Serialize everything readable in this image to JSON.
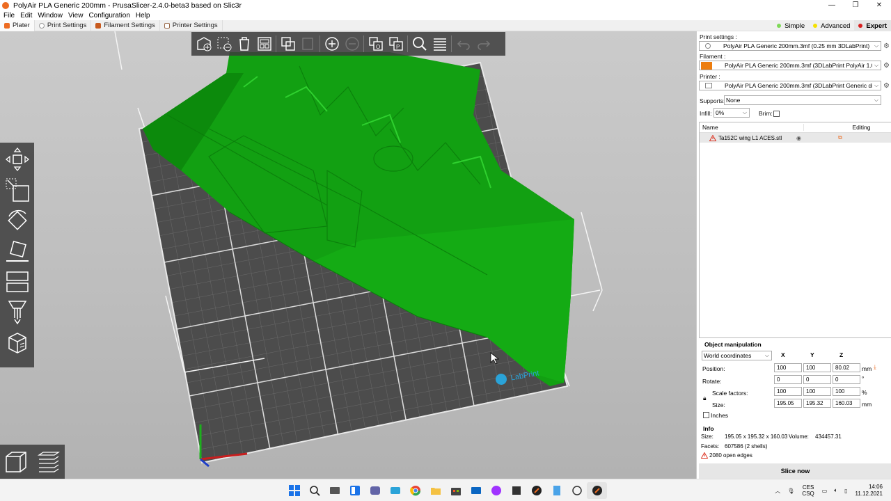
{
  "window": {
    "title": "PolyAir PLA Generic 200mm - PrusaSlicer-2.4.0-beta3 based on Slic3r",
    "minimize": "—",
    "restore": "❐",
    "close": "✕"
  },
  "menu": [
    "File",
    "Edit",
    "Window",
    "View",
    "Configuration",
    "Help"
  ],
  "tabs": [
    {
      "label": "Plater",
      "active": true,
      "color": "#ed6b21"
    },
    {
      "label": "Print Settings",
      "active": false,
      "color": "#9a9a9a"
    },
    {
      "label": "Filament Settings",
      "active": false,
      "color": "#c85a1e"
    },
    {
      "label": "Printer Settings",
      "active": false,
      "color": "#9a6a4a"
    }
  ],
  "modes": [
    {
      "label": "Simple",
      "color": "#7ed957",
      "active": false
    },
    {
      "label": "Advanced",
      "color": "#f5e100",
      "active": false
    },
    {
      "label": "Expert",
      "color": "#d81e1e",
      "active": true
    }
  ],
  "sidebar": {
    "print_settings_label": "Print settings :",
    "print_settings_value": "PolyAir PLA Generic 200mm.3mf (0.25 mm 3DLabPrint)",
    "filament_label": "Filament :",
    "filament_value": "PolyAir PLA Generic 200mm.3mf (3DLabPrint PolyAir 1.0)",
    "filament_color": "#ed7d0e",
    "printer_label": "Printer :",
    "printer_value": "PolyAir PLA Generic 200mm.3mf (3DLabPrint Generic direct e",
    "supports_label": "Supports:",
    "supports_value": "None",
    "infill_label": "Infill:",
    "infill_value": "0%",
    "brim_label": "Brim:",
    "object_list": {
      "col_name": "Name",
      "col_editing": "Editing",
      "items": [
        {
          "name": "Ta152C wing L1 ACES.stl"
        }
      ]
    }
  },
  "object_manipulation": {
    "title": "Object manipulation",
    "coord_system": "World coordinates",
    "axes": [
      "X",
      "Y",
      "Z"
    ],
    "position_label": "Position:",
    "position": [
      "100",
      "100",
      "80.02"
    ],
    "position_unit": "mm",
    "rotate_label": "Rotate:",
    "rotate": [
      "0",
      "0",
      "0"
    ],
    "rotate_unit": "°",
    "scale_label": "Scale factors:",
    "scale": [
      "100",
      "100",
      "100"
    ],
    "scale_unit": "%",
    "size_label": "Size:",
    "size": [
      "195.05",
      "195.32",
      "160.03"
    ],
    "size_unit": "mm",
    "inches_label": "Inches"
  },
  "info": {
    "title": "Info",
    "size_label": "Size:",
    "size_value": "195.05 x 195.32 x 160.03",
    "volume_label": "Volume:",
    "volume_value": "434457.31",
    "facets_label": "Facets:",
    "facets_value": "607586 (2 shells)",
    "open_edges": "2080 open edges"
  },
  "slice_button": "Slice now",
  "viewport": {
    "bed_logo_text": "LabPrint",
    "model_color": "#13a513"
  },
  "toolbar_icons": [
    "add-icon",
    "delete-icon",
    "delete-all-icon",
    "arrange-icon",
    "copy-icon",
    "paste-icon",
    "add-instance-icon",
    "remove-instance-icon",
    "split-objects-icon",
    "split-parts-icon",
    "search-icon",
    "layers-editing-icon",
    "undo-icon",
    "redo-icon"
  ],
  "gizmo_icons": [
    "move-icon",
    "scale-icon",
    "rotate-icon",
    "place-on-face-icon",
    "cut-icon",
    "supports-paint-icon",
    "seam-paint-icon"
  ],
  "taskbar": {
    "lang_top": "CES",
    "lang_bottom": "CSQ",
    "time": "14:06",
    "date": "11.12.2021"
  }
}
